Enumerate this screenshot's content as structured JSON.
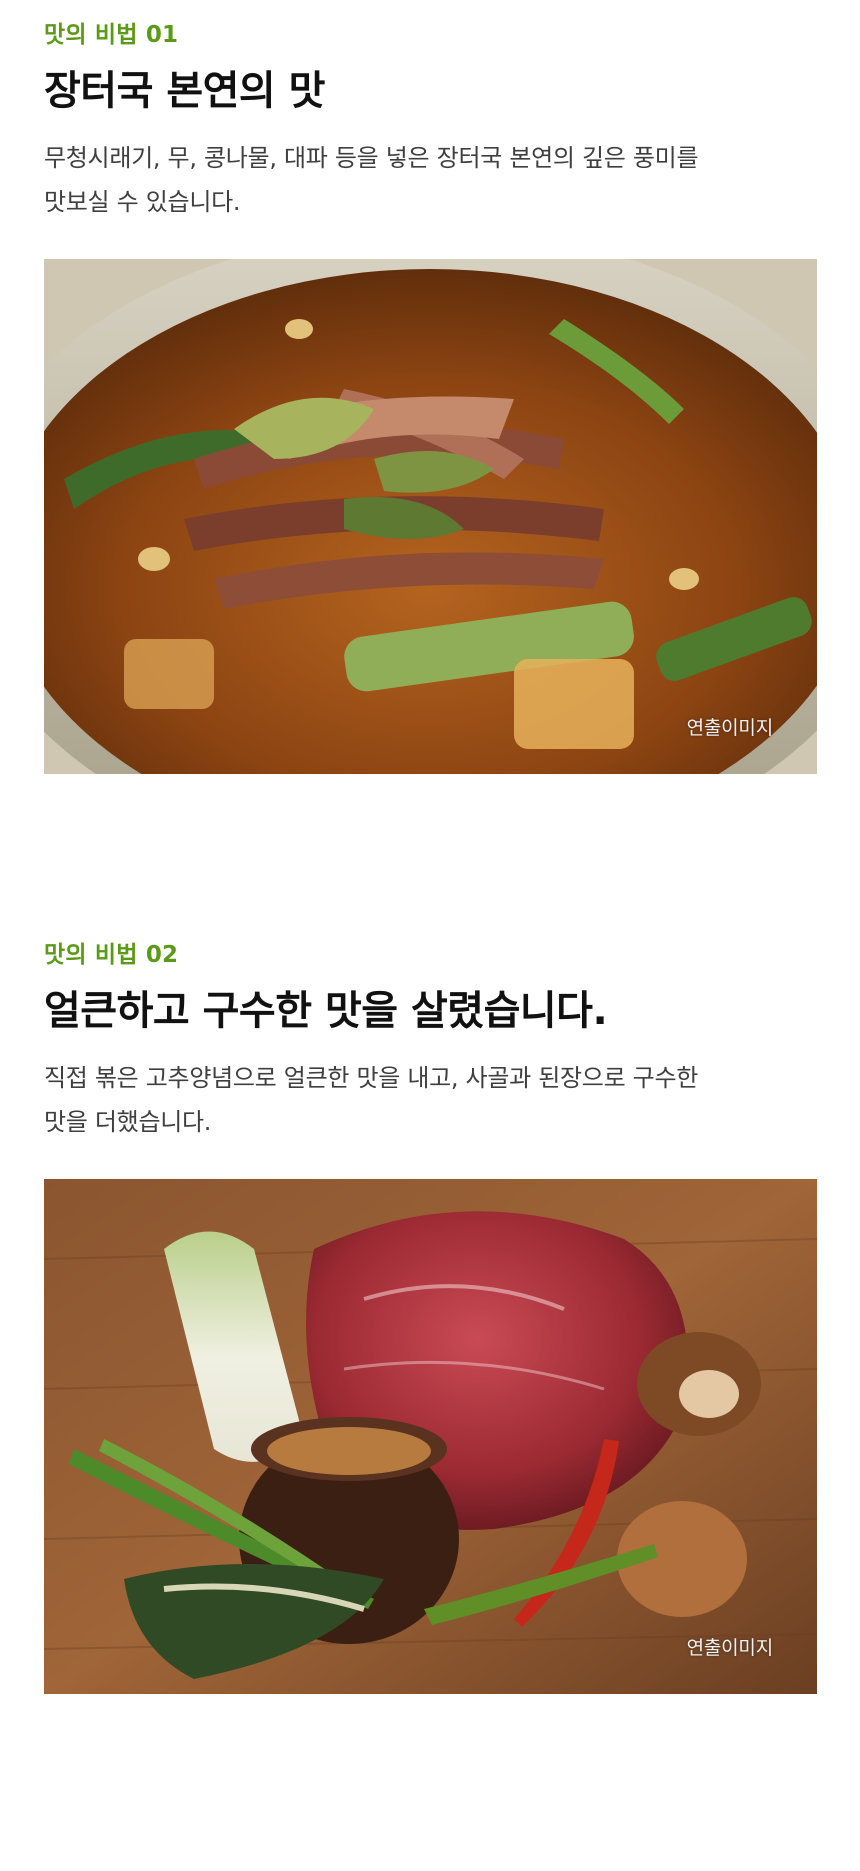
{
  "sections": [
    {
      "eyebrow": "맛의 비법 01",
      "headline": "장터국 본연의 맛",
      "desc_lines": [
        "무청시래기, 무, 콩나물, 대파 등을 넣은 장터국 본연의 깊은 풍미를",
        "맛보실 수 있습니다."
      ],
      "image_caption": "연출이미지",
      "image_subject": "soup-bowl-image"
    },
    {
      "eyebrow": "맛의 비법 02",
      "headline": "얼큰하고 구수한 맛을 살렸습니다.",
      "desc_lines": [
        "직접 볶은 고추양념으로 얼큰한 맛을 내고, 사골과 된장으로 구수한",
        "맛을 더했습니다."
      ],
      "image_caption": "연출이미지",
      "image_subject": "ingredients-image"
    }
  ],
  "colors": {
    "accent": "#5a9a16",
    "headline": "#111111",
    "body": "#3f3f3f",
    "background": "#ffffff"
  }
}
